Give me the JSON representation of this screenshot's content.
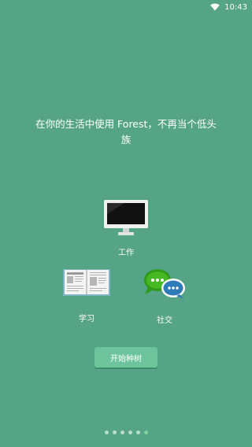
{
  "status_bar": {
    "time": "10:43",
    "wifi_icon": "wifi-icon"
  },
  "onboarding": {
    "headline": "在你的生活中使用 Forest，不再当个低头族",
    "items": [
      {
        "label": "工作",
        "icon": "monitor-icon"
      },
      {
        "label": "学习",
        "icon": "open-book-icon"
      },
      {
        "label": "社交",
        "icon": "chat-bubbles-icon"
      }
    ],
    "start_button": "开始种树"
  },
  "pager": {
    "total": 6,
    "active_index": 5
  },
  "colors": {
    "background": "#56a486",
    "button": "#6dc49c",
    "dot": "#b9dccd",
    "dot_active": "#7ed3a3"
  }
}
